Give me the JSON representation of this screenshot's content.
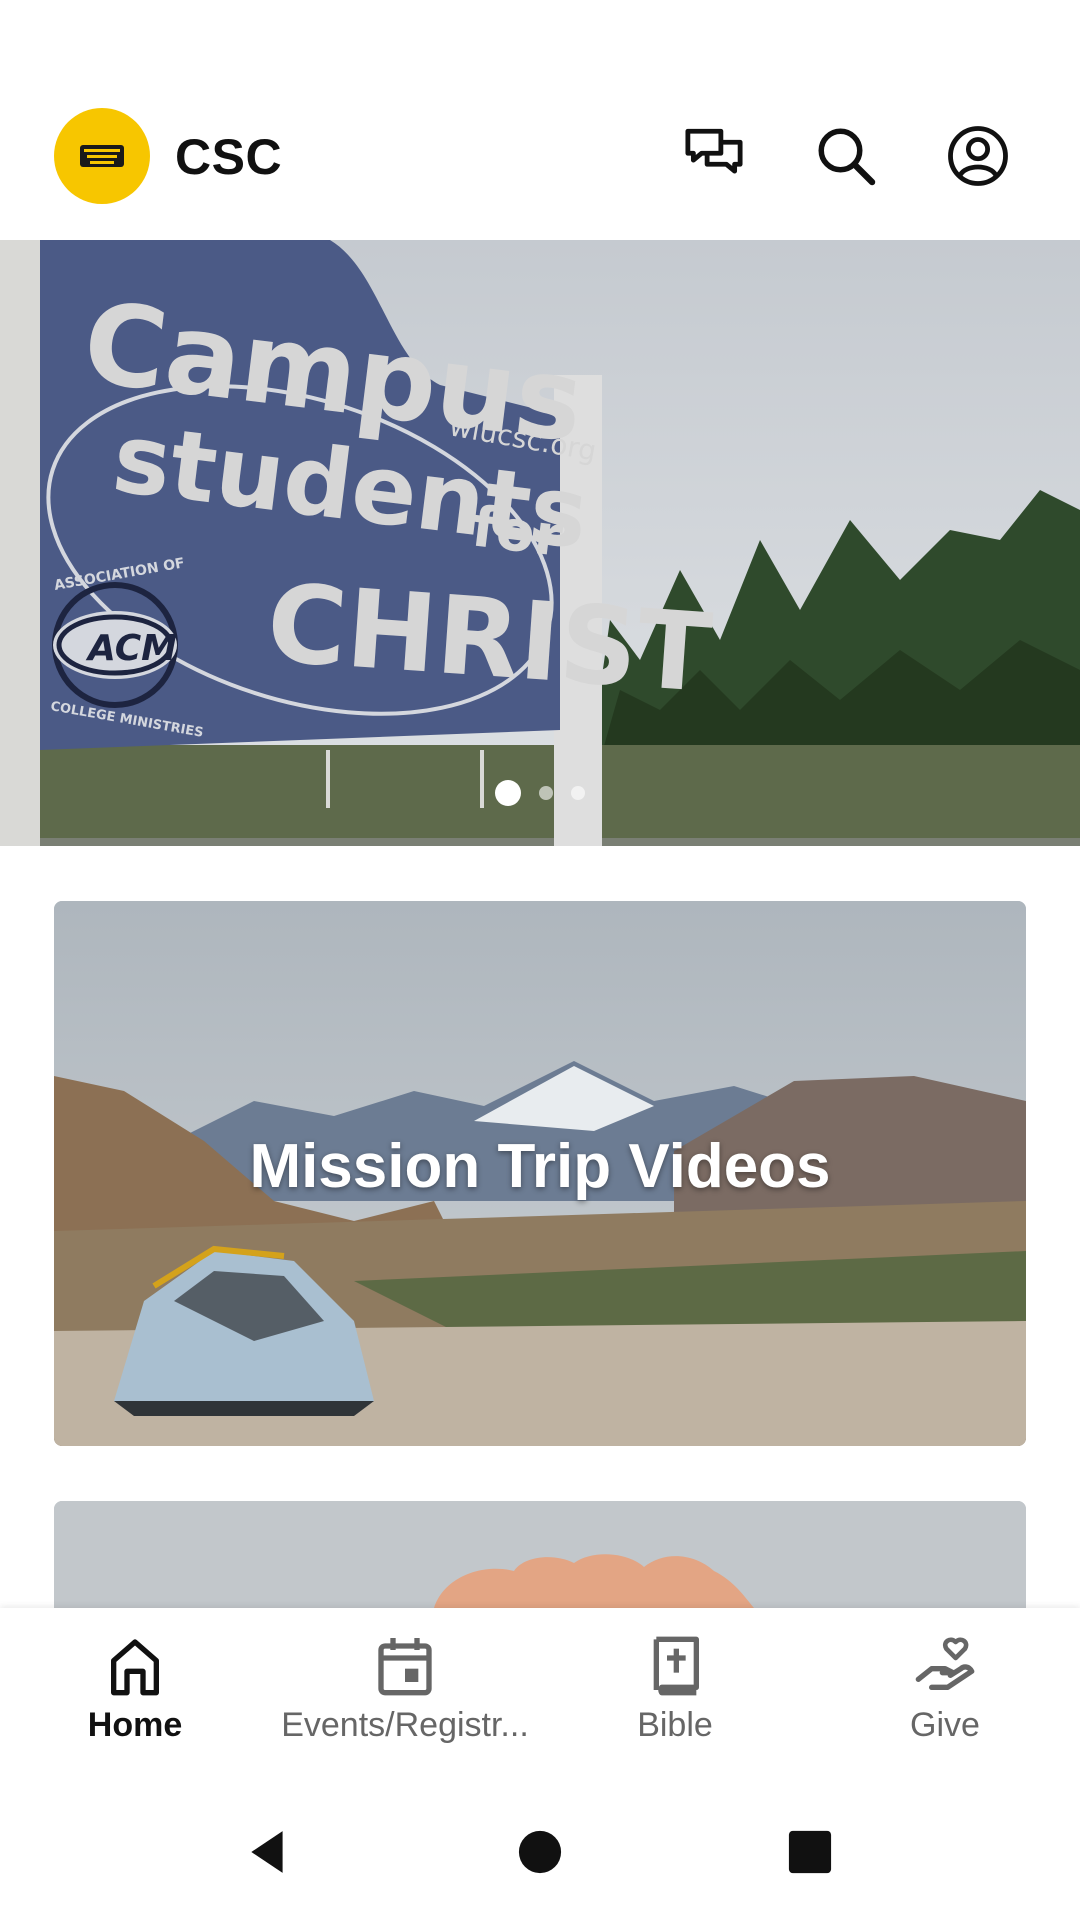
{
  "app": {
    "title": "CSC"
  },
  "colors": {
    "brand_yellow": "#f7c600",
    "nav_active": "#111111",
    "nav_inactive": "#666666",
    "sign_blue": "#4b5a86"
  },
  "header": {
    "logo_text": "Campus Students for CHRIST",
    "actions": [
      {
        "name": "chat-icon"
      },
      {
        "name": "search-icon"
      },
      {
        "name": "account-icon"
      }
    ]
  },
  "hero": {
    "sign": {
      "line1": "Campus",
      "line2": "students",
      "line3": "for",
      "line4": "CHRIST",
      "website": "wiucsc.org",
      "badge_top": "ASSOCIATION OF",
      "badge_mid": "ACM",
      "badge_bottom": "COLLEGE MINISTRIES"
    },
    "slide_count": 3,
    "active_slide": 1
  },
  "cards": [
    {
      "title": "Mission Trip Videos"
    },
    {
      "title": ""
    }
  ],
  "bottom_nav": {
    "items": [
      {
        "label": "Home",
        "icon": "home-icon",
        "active": true
      },
      {
        "label": "Events/Registr...",
        "icon": "calendar-icon",
        "active": false
      },
      {
        "label": "Bible",
        "icon": "bible-icon",
        "active": false
      },
      {
        "label": "Give",
        "icon": "give-icon",
        "active": false
      }
    ]
  }
}
